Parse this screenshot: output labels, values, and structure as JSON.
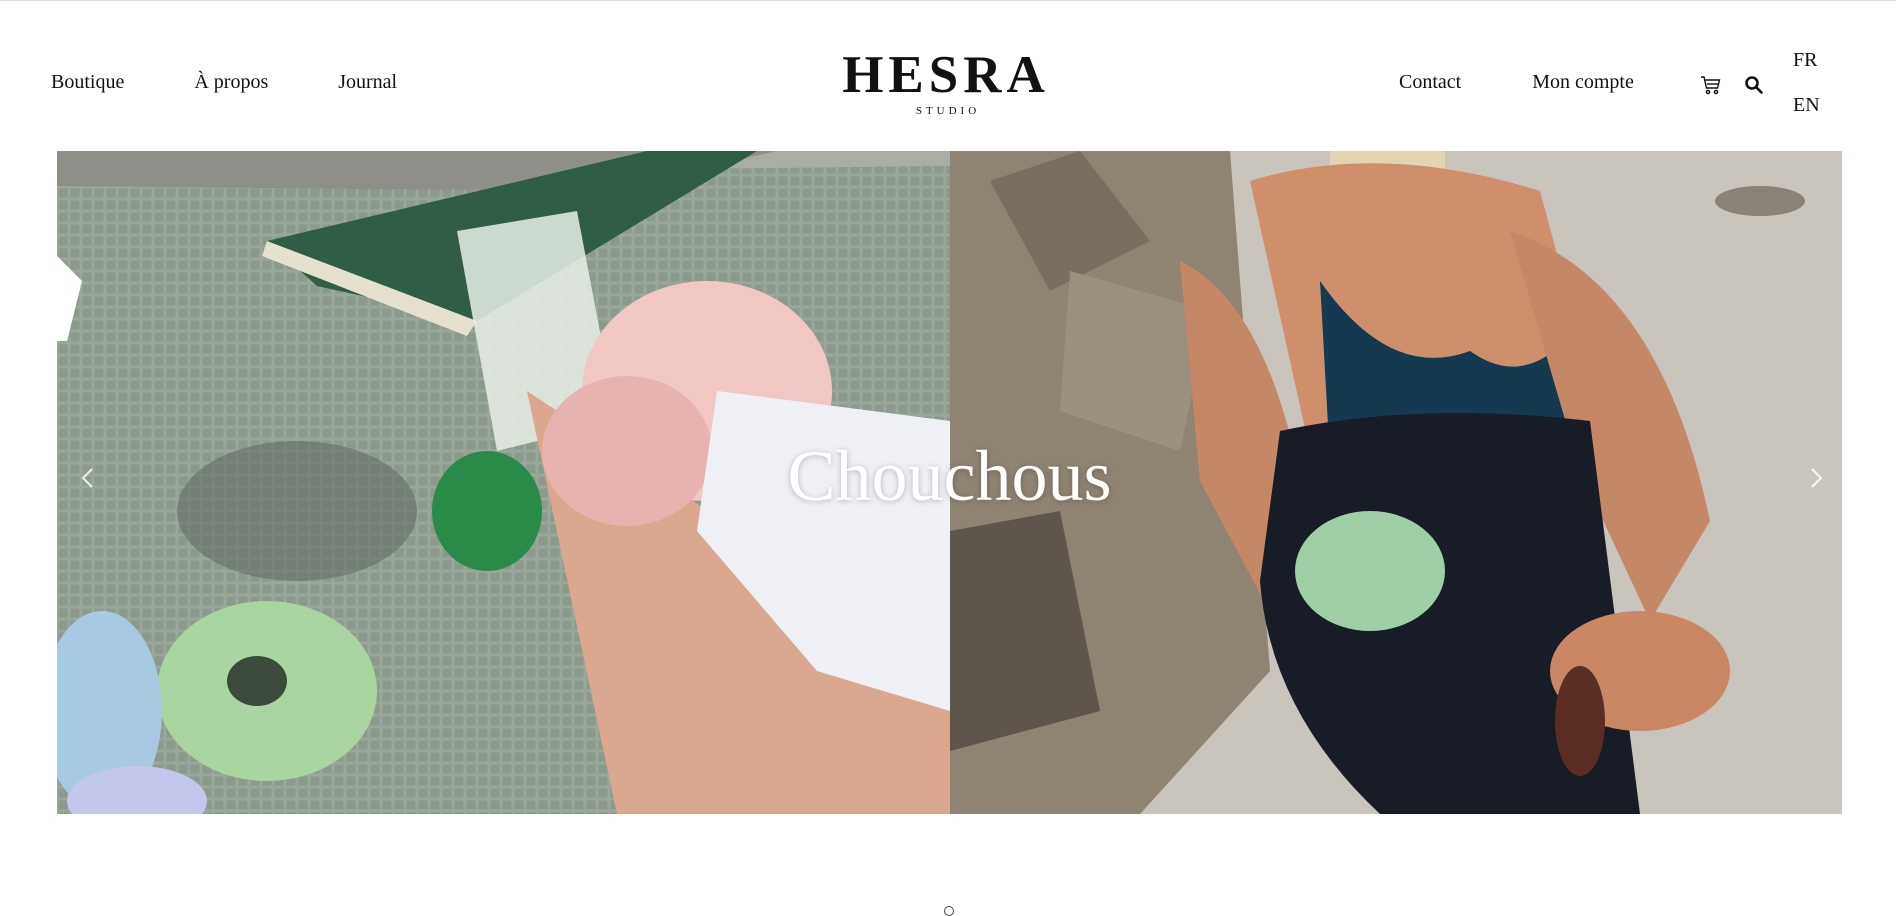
{
  "header": {
    "nav_left": [
      {
        "label": "Boutique"
      },
      {
        "label": "À propos"
      },
      {
        "label": "Journal"
      }
    ],
    "logo": {
      "title": "HESRA",
      "subtitle": "STUDIO"
    },
    "nav_right": [
      {
        "label": "Contact"
      },
      {
        "label": "Mon compte"
      }
    ],
    "icons": {
      "cart": "cart-icon",
      "search": "search-icon"
    },
    "languages": [
      "FR",
      "EN"
    ]
  },
  "hero": {
    "title": "Chouchous",
    "icons": {
      "prev": "chevron-left-icon",
      "next": "chevron-right-icon"
    }
  },
  "colors": {
    "text": "#111111",
    "hero_title": "#ffffff",
    "towel": "#98a598",
    "sand": "#c9c4bc"
  }
}
